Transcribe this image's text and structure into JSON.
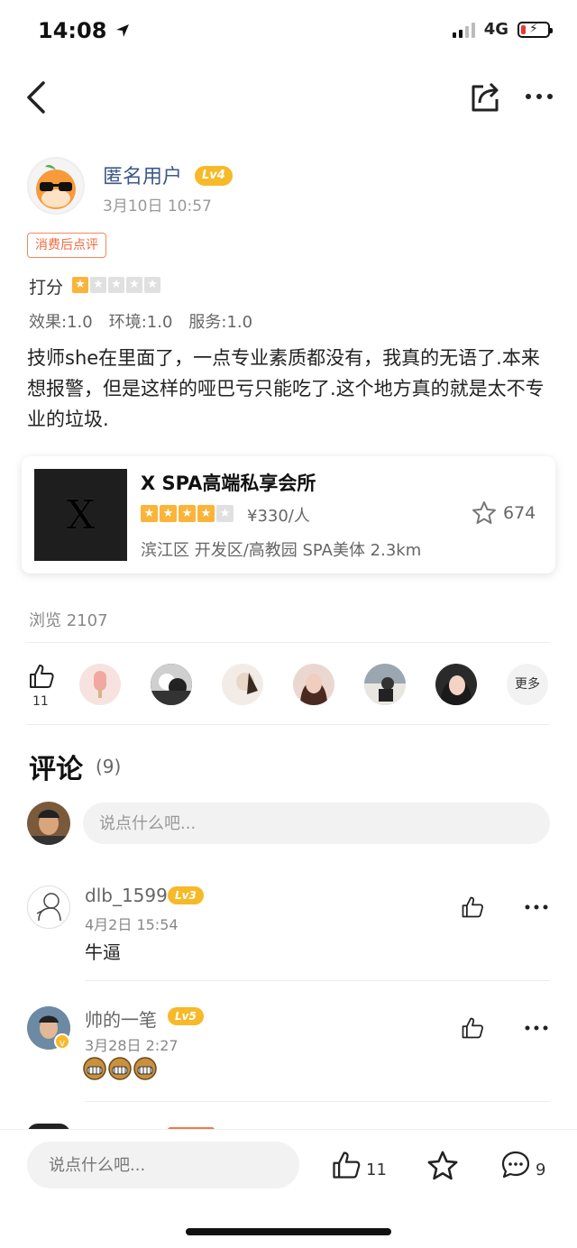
{
  "status_bar": {
    "time": "14:08",
    "network": "4G"
  },
  "review": {
    "author": "匿名用户",
    "author_level": "Lv4",
    "time": "3月10日  10:57",
    "tag": "消费后点评",
    "score_label": "打分",
    "star_rating": 1,
    "sub_scores": [
      "效果:1.0",
      "环境:1.0",
      "服务:1.0"
    ],
    "text": "技师she在里面了，一点专业素质都没有，我真的无语了.本来想报警，但是这样的哑巴亏只能吃了.这个地方真的就是太不专业的垃圾."
  },
  "shop": {
    "logo_letter": "X",
    "name": "X SPA高端私享会所",
    "rating": 4,
    "price": "¥330/人",
    "favorites": "674",
    "location": "滨江区 开发区/高教园 SPA美体  2.3km"
  },
  "views": "浏览 2107",
  "likes": {
    "count": "11",
    "more_label": "更多"
  },
  "comments": {
    "title": "评论",
    "count": "(9)",
    "input_placeholder": "说点什么吧...",
    "items": [
      {
        "name": "dlb_1599",
        "level": "Lv3",
        "time": "4月2日  15:54",
        "text": "牛逼"
      },
      {
        "name": "帅的一笔",
        "level": "Lv5",
        "time": "3月28日  2:27",
        "text": ""
      }
    ]
  },
  "bottom_bar": {
    "placeholder": "说点什么吧...",
    "likes": "11",
    "comments": "9"
  },
  "colors": {
    "accent_orange": "#f7b928",
    "link_blue": "#3d5a88",
    "tag_red": "#f06a3d"
  }
}
